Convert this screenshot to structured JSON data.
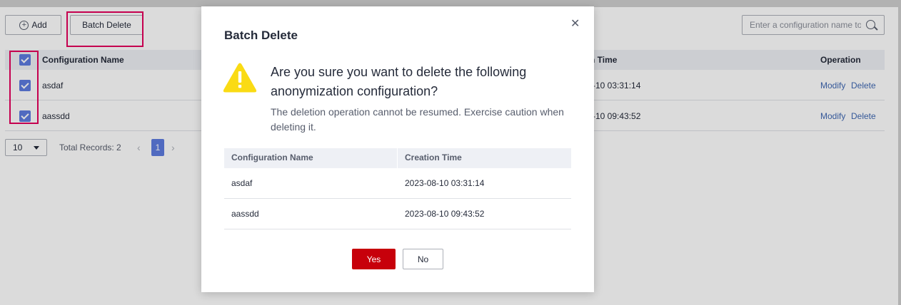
{
  "toolbar": {
    "add_label": "Add",
    "batch_delete_label": "Batch Delete",
    "search_placeholder": "Enter a configuration name to"
  },
  "table": {
    "columns": [
      "Configuration Name",
      "Creation Time",
      "Operation"
    ],
    "column_partial_time": "n Time",
    "rows": [
      {
        "name": "asdaf",
        "time_partial": "-10 03:31:14",
        "modify": "Modify",
        "delete": "Delete",
        "checked": true
      },
      {
        "name": "aassdd",
        "time_partial": "-10 09:43:52",
        "modify": "Modify",
        "delete": "Delete",
        "checked": true
      }
    ]
  },
  "pager": {
    "page_size": "10",
    "total": "Total Records: 2",
    "current_page": "1"
  },
  "modal": {
    "title": "Batch Delete",
    "question": "Are you sure you want to delete the following anonymization configuration?",
    "note": "The deletion operation cannot be resumed. Exercise caution when deleting it.",
    "columns": [
      "Configuration Name",
      "Creation Time"
    ],
    "rows": [
      {
        "name": "asdaf",
        "time": "2023-08-10 03:31:14"
      },
      {
        "name": "aassdd",
        "time": "2023-08-10 09:43:52"
      }
    ],
    "yes_label": "Yes",
    "no_label": "No",
    "close_glyph": "✕"
  },
  "icons": {
    "warning": "warning-icon",
    "close": "close-icon",
    "search": "search-icon",
    "add": "plus-circle-icon"
  },
  "colors": {
    "primary": "#5e7ce0",
    "danger_button": "#c7000b",
    "link": "#3f68b3",
    "warning": "#fadb14",
    "highlight": "#e6005c"
  }
}
